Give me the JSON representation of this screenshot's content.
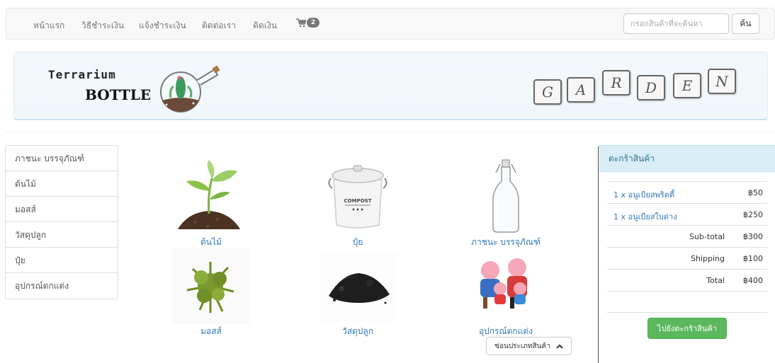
{
  "nav": {
    "items": [
      "หน้าแรก",
      "วิธีชำระเงิน",
      "แจ้งชำระเงิน",
      "ติดต่อเรา",
      "คิดเงิน"
    ],
    "cart_count": "2",
    "search_placeholder": "กรอกสินค้าที่จะค้นหา",
    "search_button": "ค้น"
  },
  "banner": {
    "logo_line1": "Terrarium",
    "logo_line2": "BOTTLE",
    "letters": [
      "G",
      "A",
      "R",
      "D",
      "E",
      "N"
    ]
  },
  "sidebar": {
    "items": [
      "ภาชนะ บรรจุภัณฑ์",
      "ต้นไม้",
      "มอสส์",
      "วัสดุปลูก",
      "ปุ๋ย",
      "อุปกรณ์ตกแต่ง"
    ]
  },
  "products": [
    {
      "label": "ต้นไม้",
      "icon": "sprout-image"
    },
    {
      "label": "ปุ๋ย",
      "icon": "compost-bin-image"
    },
    {
      "label": "ภาชนะ บรรจุภัณฑ์",
      "icon": "glass-bottle-image"
    },
    {
      "label": "มอสส์",
      "icon": "moss-image"
    },
    {
      "label": "วัสดุปลูก",
      "icon": "soil-image"
    },
    {
      "label": "อุปกรณ์ตกแต่ง",
      "icon": "pig-figurines-image"
    }
  ],
  "collapse_button": "ซ่อนประเภทสินค้า",
  "cart": {
    "title": "ตะกร้าสินค้า",
    "items": [
      {
        "name": "1 x อนูเบียสพริตตี้",
        "price": "฿50"
      },
      {
        "name": "1 x อนูเบียสใบด่าง",
        "price": "฿250"
      }
    ],
    "subtotal_label": "Sub-total",
    "subtotal": "฿300",
    "shipping_label": "Shipping",
    "shipping": "฿100",
    "total_label": "Total",
    "total": "฿400",
    "checkout_button": "ไปยังตะกร้าสินค้า"
  },
  "colors": {
    "link": "#337ab7",
    "success": "#5cb85c",
    "panel_heading": "#d9edf7"
  }
}
